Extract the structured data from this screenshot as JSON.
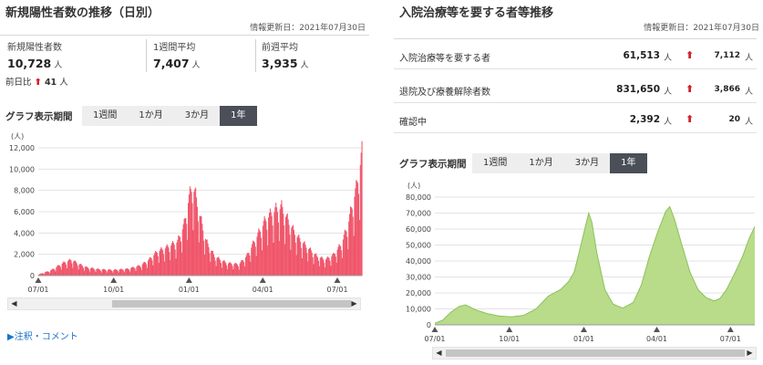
{
  "left": {
    "title": "新規陽性者数の推移（日別）",
    "updated": "情報更新日：2021年07月30日",
    "stats": [
      {
        "label": "新規陽性者数",
        "value": "10,728",
        "unit": "人"
      },
      {
        "label": "1週間平均",
        "value": "7,407",
        "unit": "人"
      },
      {
        "label": "前週平均",
        "value": "3,935",
        "unit": "人"
      }
    ],
    "delta": {
      "label": "前日比",
      "arrow": "⬆",
      "value": "41",
      "unit": "人"
    },
    "tabs_label": "グラフ表示期間",
    "tabs": [
      {
        "label": "1週間"
      },
      {
        "label": "1か月"
      },
      {
        "label": "3か月"
      },
      {
        "label": "1年",
        "active": true
      }
    ],
    "note": "▶注釈・コメント",
    "scroll_left": "◀",
    "scroll_right": "▶"
  },
  "right": {
    "title": "入院治療等を要する者等推移",
    "updated": "情報更新日：2021年07月30日",
    "rows": [
      {
        "label": "入院治療等を要する者",
        "value": "61,513",
        "unit": "人",
        "arrow": "⬆",
        "delta": "7,112",
        "delta_unit": "人"
      },
      {
        "label": "退院及び療養解除者数",
        "value": "831,650",
        "unit": "人",
        "arrow": "⬆",
        "delta": "3,866",
        "delta_unit": "人"
      },
      {
        "label": "確認中",
        "value": "2,392",
        "unit": "人",
        "arrow": "⬆",
        "delta": "20",
        "delta_unit": "人"
      }
    ],
    "tabs_label": "グラフ表示期間",
    "tabs": [
      {
        "label": "1週間"
      },
      {
        "label": "1か月"
      },
      {
        "label": "3か月"
      },
      {
        "label": "1年",
        "active": true
      }
    ],
    "scroll_left": "◀",
    "scroll_right": "▶"
  },
  "colors": {
    "bar": "#f0556a",
    "area_fill": "#b8dc8a",
    "area_line": "#8cc15a",
    "arrow": "#d21f2b",
    "active_tab": "#4a4f58"
  },
  "chart_data": [
    {
      "type": "bar",
      "title": "",
      "ylabel": "(人)",
      "ylim": [
        0,
        12000
      ],
      "yticks": [
        0,
        2000,
        4000,
        6000,
        8000,
        10000,
        12000
      ],
      "ytick_labels": [
        "0",
        "2,000",
        "4,000",
        "6,000",
        "8,000",
        "10,000",
        "12,000"
      ],
      "xtick_labels": [
        "07/01",
        "10/01",
        "01/01",
        "04/01",
        "07/01"
      ],
      "xtick_positions": [
        0,
        92,
        184,
        274,
        365
      ],
      "x_count": 396,
      "keypoints": [
        [
          0,
          100
        ],
        [
          15,
          450
        ],
        [
          30,
          1100
        ],
        [
          40,
          1400
        ],
        [
          50,
          1000
        ],
        [
          60,
          700
        ],
        [
          75,
          550
        ],
        [
          92,
          500
        ],
        [
          110,
          600
        ],
        [
          125,
          900
        ],
        [
          135,
          1400
        ],
        [
          145,
          2100
        ],
        [
          160,
          2600
        ],
        [
          170,
          3000
        ],
        [
          178,
          4500
        ],
        [
          183,
          6500
        ],
        [
          188,
          8000
        ],
        [
          192,
          7000
        ],
        [
          198,
          5000
        ],
        [
          205,
          3000
        ],
        [
          215,
          1700
        ],
        [
          230,
          1100
        ],
        [
          245,
          1000
        ],
        [
          255,
          1800
        ],
        [
          265,
          3200
        ],
        [
          278,
          5000
        ],
        [
          290,
          5800
        ],
        [
          297,
          6000
        ],
        [
          305,
          4800
        ],
        [
          315,
          3500
        ],
        [
          328,
          2500
        ],
        [
          340,
          1700
        ],
        [
          350,
          1400
        ],
        [
          360,
          1800
        ],
        [
          370,
          2800
        ],
        [
          378,
          4500
        ],
        [
          384,
          6500
        ],
        [
          388,
          7600
        ],
        [
          392,
          9500
        ],
        [
          395,
          10700
        ]
      ],
      "grid": true
    },
    {
      "type": "area",
      "title": "",
      "ylabel": "(人)",
      "ylim": [
        0,
        80000
      ],
      "yticks": [
        0,
        10000,
        20000,
        30000,
        40000,
        50000,
        60000,
        70000,
        80000
      ],
      "ytick_labels": [
        "0",
        "10,000",
        "20,000",
        "30,000",
        "40,000",
        "50,000",
        "60,000",
        "70,000",
        "80,000"
      ],
      "xtick_labels": [
        "07/01",
        "10/01",
        "01/01",
        "04/01",
        "07/01"
      ],
      "xtick_positions": [
        0,
        92,
        184,
        274,
        365
      ],
      "x_count": 396,
      "keypoints": [
        [
          0,
          1000
        ],
        [
          10,
          3000
        ],
        [
          20,
          8000
        ],
        [
          30,
          11500
        ],
        [
          38,
          12500
        ],
        [
          50,
          9500
        ],
        [
          65,
          7000
        ],
        [
          80,
          5500
        ],
        [
          95,
          5000
        ],
        [
          110,
          6000
        ],
        [
          125,
          10000
        ],
        [
          140,
          18000
        ],
        [
          155,
          22000
        ],
        [
          165,
          27000
        ],
        [
          172,
          33000
        ],
        [
          178,
          45000
        ],
        [
          186,
          62000
        ],
        [
          190,
          70000
        ],
        [
          194,
          64000
        ],
        [
          200,
          45000
        ],
        [
          210,
          22000
        ],
        [
          220,
          13000
        ],
        [
          232,
          10500
        ],
        [
          245,
          14000
        ],
        [
          255,
          25000
        ],
        [
          265,
          43000
        ],
        [
          275,
          58000
        ],
        [
          285,
          71000
        ],
        [
          290,
          74000
        ],
        [
          296,
          66000
        ],
        [
          305,
          50000
        ],
        [
          315,
          33000
        ],
        [
          325,
          22000
        ],
        [
          335,
          17000
        ],
        [
          345,
          15000
        ],
        [
          352,
          16500
        ],
        [
          360,
          22000
        ],
        [
          370,
          32000
        ],
        [
          380,
          43000
        ],
        [
          388,
          54000
        ],
        [
          395,
          61500
        ]
      ],
      "grid": true
    }
  ]
}
